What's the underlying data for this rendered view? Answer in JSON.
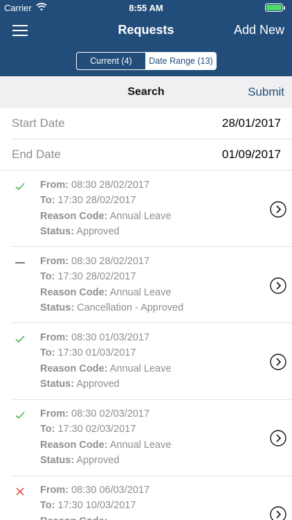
{
  "status_bar": {
    "carrier": "Carrier",
    "time": "8:55 AM",
    "battery_level": 1.0
  },
  "nav": {
    "title": "Requests",
    "add_label": "Add New"
  },
  "segments": {
    "current": "Current (4)",
    "date_range": "Date Range (13)"
  },
  "search": {
    "title": "Search",
    "submit_label": "Submit"
  },
  "filters": {
    "start_label": "Start Date",
    "start_value": "28/01/2017",
    "end_label": "End Date",
    "end_value": "01/09/2017"
  },
  "field_labels": {
    "from": "From:",
    "to": "To:",
    "reason": "Reason Code:",
    "status": "Status:"
  },
  "colors": {
    "nav_bg": "#224d7a",
    "approved": "#4caf50",
    "rejected": "#e53935",
    "cancelled": "#555555"
  },
  "requests": [
    {
      "mark": "check-icon",
      "from": "08:30 28/02/2017",
      "to": "17:30 28/02/2017",
      "reason": "Annual Leave",
      "status": "Approved"
    },
    {
      "mark": "dash-icon",
      "from": "08:30 28/02/2017",
      "to": "17:30 28/02/2017",
      "reason": "Annual Leave",
      "status": "Cancellation - Approved"
    },
    {
      "mark": "check-icon",
      "from": "08:30 01/03/2017",
      "to": "17:30 01/03/2017",
      "reason": "Annual Leave",
      "status": "Approved"
    },
    {
      "mark": "check-icon",
      "from": "08:30 02/03/2017",
      "to": "17:30 02/03/2017",
      "reason": "Annual Leave",
      "status": "Approved"
    },
    {
      "mark": "cross-icon",
      "from": "08:30 06/03/2017",
      "to": "17:30 10/03/2017",
      "reason": "",
      "status": ""
    }
  ]
}
